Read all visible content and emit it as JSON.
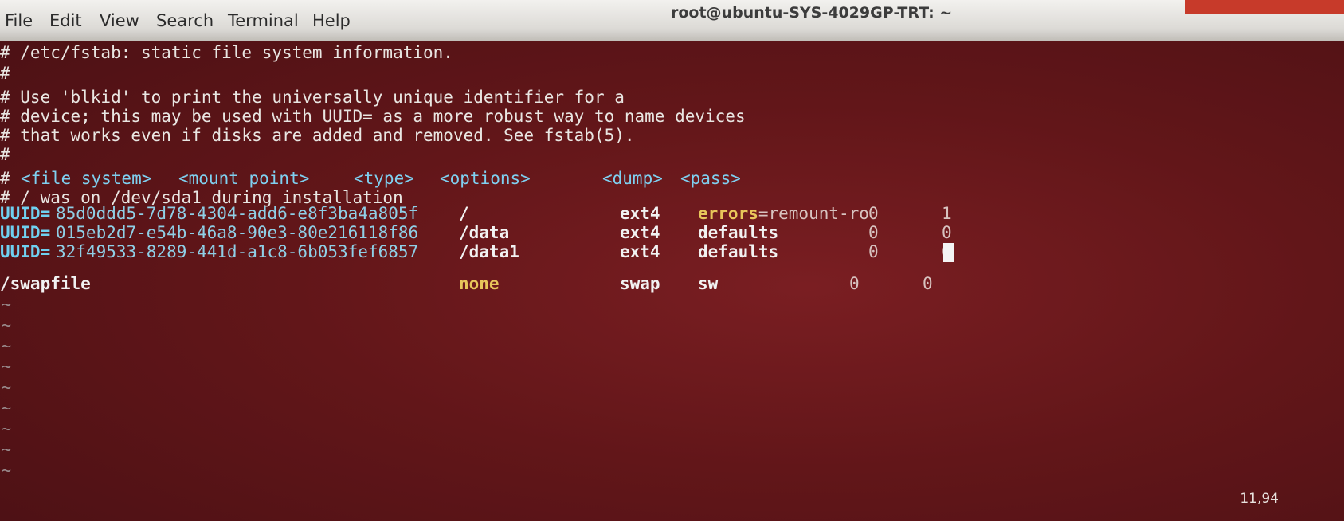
{
  "window": {
    "title": "root@ubuntu-SYS-4029GP-TRT: ~"
  },
  "menu": [
    "File",
    "Edit",
    "View",
    "Search",
    "Terminal",
    "Help"
  ],
  "comments": [
    "# /etc/fstab: static file system information.",
    "#",
    "# Use 'blkid' to print the universally unique identifier for a",
    "# device; this may be used with UUID= as a more robust way to name devices",
    "# that works even if disks are added and removed. See fstab(5).",
    "#"
  ],
  "header": {
    "hash": "#",
    "file_system": "<file system>",
    "mount_point": "<mount point>",
    "type": "<type>",
    "options": "<options>",
    "dump": "<dump>",
    "pass": "<pass>"
  },
  "install_note": "# / was on /dev/sda1 during installation",
  "entries": [
    {
      "key": "UUID=",
      "uuid": "85d0ddd5-7d78-4304-add6-e8f3ba4a805f",
      "mount": "/",
      "type": "ext4",
      "options_key": "errors",
      "options_rest": "=remount-ro",
      "dump": "0",
      "pass": "1"
    },
    {
      "key": "UUID=",
      "uuid": "015eb2d7-e54b-46a8-90e3-80e216118f86",
      "mount": "/data",
      "type": "ext4",
      "options_key": "defaults",
      "options_rest": "",
      "dump": "0",
      "pass": "0"
    },
    {
      "key": "UUID=",
      "uuid": "32f49533-8289-441d-a1c8-6b053fef6857",
      "mount": "/data1",
      "type": "ext4",
      "options_key": "defaults",
      "options_rest": "",
      "dump": "0",
      "pass": "0"
    }
  ],
  "swap": {
    "file": "/swapfile",
    "mount": "none",
    "type": "swap",
    "options": "sw",
    "dump": "0",
    "pass": "0"
  },
  "empty_marker": "~",
  "status": {
    "position": "11,94"
  }
}
